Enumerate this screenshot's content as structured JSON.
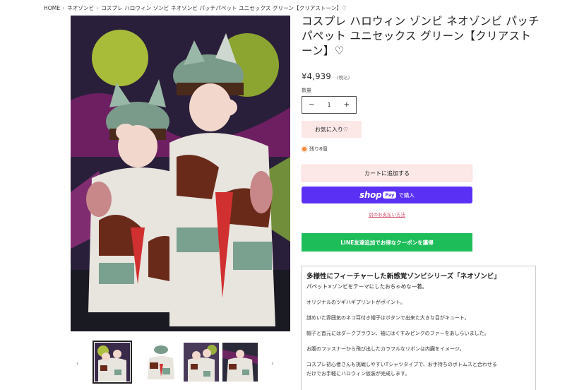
{
  "breadcrumb": {
    "items": [
      "HOME",
      "ネオゾンビ",
      "コスプレ ハロウィン ゾンビ ネオゾンビ パッチパペット ユニセックス グリーン【クリアストーン】♡"
    ],
    "separator": "›"
  },
  "product": {
    "title": "コスプレ ハロウィン ゾンビ ネオゾンビ パッチパペット ユニセックス グリーン【クリアストーン】♡",
    "price": "¥4,939",
    "tax_note": "(税込)",
    "quantity_label": "数量",
    "quantity_value": "1",
    "minus": "−",
    "plus": "+",
    "favorite_label": "お気に入り♡",
    "stock_label": "残り8個",
    "add_to_cart": "カートに追加する",
    "shoppay_brand": "shop",
    "shoppay_pay": "Pay",
    "shoppay_buy": "で購入",
    "other_payment": "別のお支払い方法",
    "line_button": "LINE友達追加でお得なクーポンを獲得"
  },
  "description": {
    "heading": "多様性にフィーチャーした新感覚ゾンビシリーズ「ネオゾンビ」",
    "subheading": "パペット×ゾンビをテーマにしたおちゃめな一着。",
    "paragraphs": [
      "オリジナルのツギハギプリントがポイント。",
      "謎めいた雰囲気のネコ耳付き帽子はボタンで出来た大きな目がキュート。",
      "帽子と首元にはダークブラウン、袖にはくすみピンクのファーをあしらいました。",
      "お腹のファスナーから飛び出したカラフルなリボンは内臓をイメージ。",
      "コスプレ初心者さんも挑戦しやすいTシャツタイプで、お手持ちのボトムスと合わせる"
    ],
    "continuation": "だけでお手軽にハロウィン仮装が完成します。"
  },
  "gallery": {
    "prev": "‹",
    "next": "›"
  },
  "colors": {
    "accent_pink": "#fde8e8",
    "shoppay": "#5a31f4",
    "line_green": "#1dbe5a",
    "stock_dot": "#f08a3c"
  }
}
